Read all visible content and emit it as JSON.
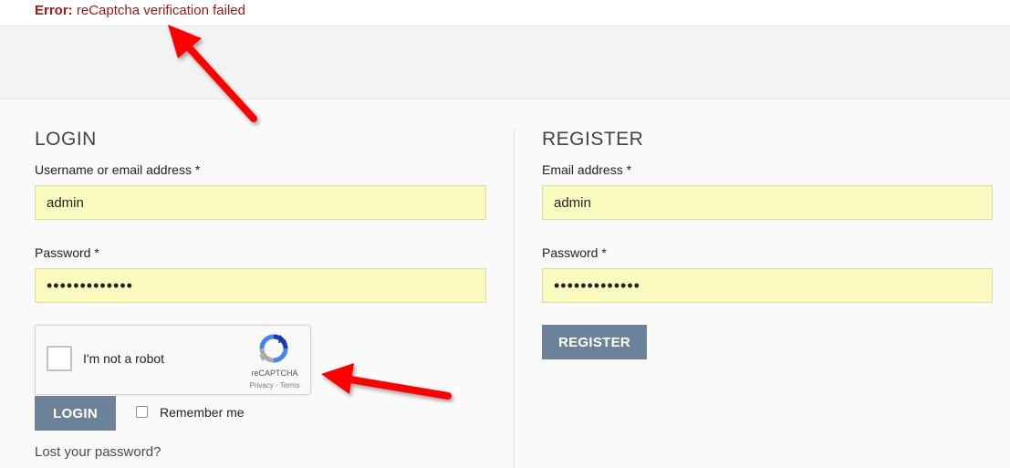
{
  "notice": {
    "error_label": "Error:",
    "error_message": "reCaptcha verification failed"
  },
  "login": {
    "title": "LOGIN",
    "username_label": "Username or email address *",
    "username_value": "admin",
    "password_label": "Password *",
    "password_value": "•••••••••••••",
    "button_label": "LOGIN",
    "remember_label": "Remember me",
    "lost_password": "Lost your password?"
  },
  "captcha": {
    "label": "I'm not a robot",
    "brand": "reCAPTCHA",
    "links": "Privacy - Terms"
  },
  "register": {
    "title": "REGISTER",
    "email_label": "Email address *",
    "email_value": "admin",
    "password_label": "Password *",
    "password_value": "•••••••••••••",
    "button_label": "REGISTER"
  },
  "colors": {
    "error": "#a11919",
    "input_autofill": "#fafcbf",
    "button": "#6c8299",
    "annotation_arrow": "#ff0000"
  },
  "icons": [
    "recaptcha-logo-icon",
    "annotation-arrow-icon"
  ]
}
